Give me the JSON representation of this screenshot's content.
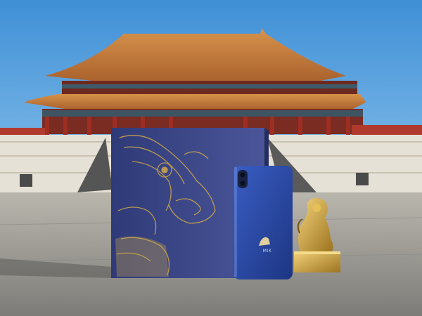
{
  "scene": {
    "description_colors": {
      "sky": "#5aa3e0",
      "roof": "#c97a3a",
      "box": "#3c4a8c",
      "gold": "#c9a44a",
      "phone": "#2a4aa8",
      "ground": "#9a9a98"
    },
    "phone_brand_text": "MIX"
  }
}
